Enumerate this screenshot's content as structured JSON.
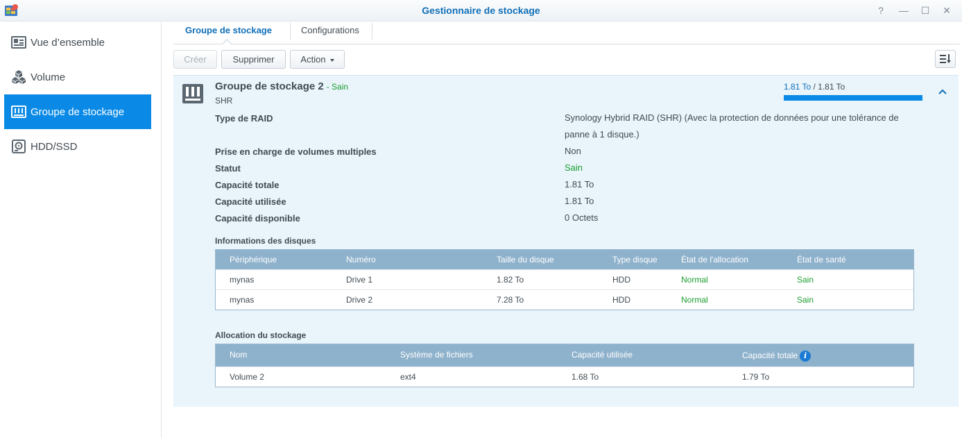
{
  "window": {
    "title": "Gestionnaire de stockage",
    "help": "?",
    "minimize": "—",
    "maximize": "☐",
    "close": "✕"
  },
  "sidebar": {
    "items": [
      {
        "label": "Vue d’ensemble",
        "icon": "overview-icon"
      },
      {
        "label": "Volume",
        "icon": "volume-cubes-icon"
      },
      {
        "label": "Groupe de stockage",
        "icon": "storage-pool-icon",
        "active": true
      },
      {
        "label": "HDD/SSD",
        "icon": "hdd-icon"
      }
    ]
  },
  "tabs": [
    {
      "label": "Groupe de stockage",
      "active": true
    },
    {
      "label": "Configurations"
    }
  ],
  "toolbar": {
    "create_label": "Créer",
    "delete_label": "Supprimer",
    "action_label": "Action"
  },
  "pool": {
    "title": "Groupe de stockage 2",
    "status": "- Sain",
    "subtitle": "SHR",
    "used": "1.81 To",
    "separator": " / ",
    "total": "1.81 To",
    "usage_fraction": 1.0,
    "properties": [
      {
        "label": "Type de RAID",
        "value": "Synology Hybrid RAID (SHR) (Avec la protection de données pour une tolérance de panne à 1 disque.)"
      },
      {
        "label": "Prise en charge de volumes multiples",
        "value": "Non"
      },
      {
        "label": "Statut",
        "value": "Sain",
        "ok": true
      },
      {
        "label": "Capacité totale",
        "value": "1.81 To"
      },
      {
        "label": "Capacité utilisée",
        "value": "1.81 To"
      },
      {
        "label": "Capacité disponible",
        "value": "0 Octets"
      }
    ]
  },
  "disks": {
    "title": "Informations des disques",
    "columns": [
      "Périphérique",
      "Numéro",
      "Taille du disque",
      "Type disque",
      "État de l'allocation",
      "État de santé"
    ],
    "rows": [
      [
        "mynas",
        "Drive 1",
        "1.82 To",
        "HDD",
        "Normal",
        "Sain"
      ],
      [
        "mynas",
        "Drive 2",
        "7.28 To",
        "HDD",
        "Normal",
        "Sain"
      ]
    ]
  },
  "allocation": {
    "title": "Allocation du stockage",
    "columns": [
      "Nom",
      "Système de fichiers",
      "Capacité utilisée",
      "Capacité totale"
    ],
    "rows": [
      [
        "Volume 2",
        "ext4",
        "1.68 To",
        "1.79 To"
      ]
    ],
    "info_glyph": "i"
  },
  "colors": {
    "accent": "#0a8ae6",
    "title": "#0f6fb8",
    "ok": "#1b9e2e",
    "table_header": "#8fb2cc",
    "panel": "#e9f4fb"
  }
}
